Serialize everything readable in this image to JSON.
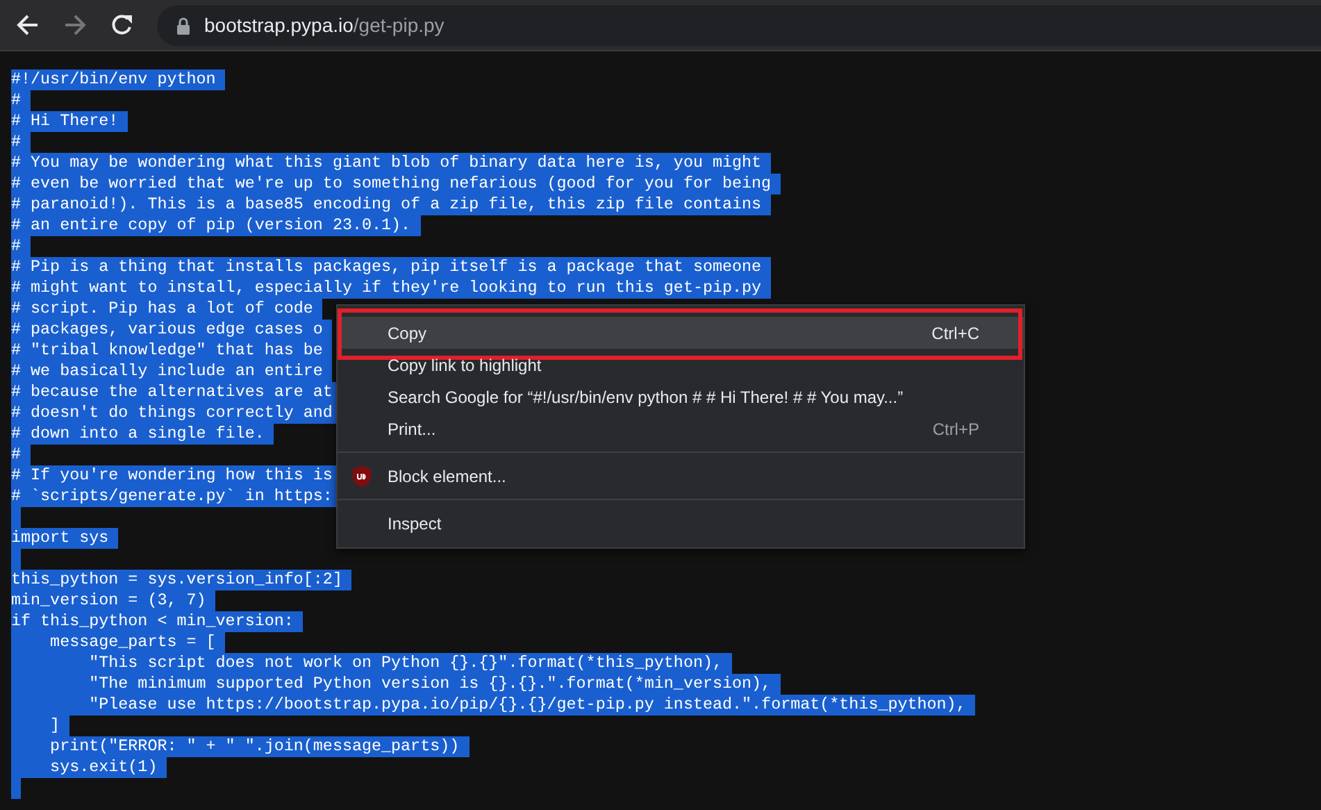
{
  "toolbar": {
    "back": {
      "disabled": false
    },
    "forward": {
      "disabled": true
    },
    "url": {
      "host": "bootstrap.pypa.io",
      "path": "/get-pip.py"
    }
  },
  "code": {
    "selected": true,
    "lines": [
      {
        "kind": "text",
        "text": "#!/usr/bin/env python"
      },
      {
        "kind": "text",
        "text": "#"
      },
      {
        "kind": "text",
        "text": "# Hi There!"
      },
      {
        "kind": "text",
        "text": "#"
      },
      {
        "kind": "text",
        "text": "# You may be wondering what this giant blob of binary data here is, you might"
      },
      {
        "kind": "text",
        "text": "# even be worried that we're up to something nefarious (good for you for being"
      },
      {
        "kind": "text",
        "text": "# paranoid!). This is a base85 encoding of a zip file, this zip file contains"
      },
      {
        "kind": "text",
        "text": "# an entire copy of pip (version 23.0.1)."
      },
      {
        "kind": "text",
        "text": "#"
      },
      {
        "kind": "text",
        "text": "# Pip is a thing that installs packages, pip itself is a package that someone"
      },
      {
        "kind": "text",
        "text": "# might want to install, especially if they're looking to run this get-pip.py"
      },
      {
        "kind": "text",
        "text": "# script. Pip has a lot of code"
      },
      {
        "kind": "text",
        "text": "# packages, various edge cases o"
      },
      {
        "kind": "text",
        "text": "# \"tribal knowledge\" that has be"
      },
      {
        "kind": "text",
        "text": "# we basically include an entire"
      },
      {
        "kind": "text",
        "text": "# because the alternatives are at"
      },
      {
        "kind": "text",
        "text": "# doesn't do things correctly and"
      },
      {
        "kind": "text",
        "text": "# down into a single file."
      },
      {
        "kind": "text",
        "text": "#"
      },
      {
        "kind": "text",
        "text": "# If you're wondering how this is"
      },
      {
        "kind": "text",
        "text": "# `scripts/generate.py` in https:"
      },
      {
        "kind": "blank"
      },
      {
        "kind": "text",
        "text": "import sys"
      },
      {
        "kind": "blank"
      },
      {
        "kind": "text",
        "text": "this_python = sys.version_info[:2]"
      },
      {
        "kind": "text",
        "text": "min_version = (3, 7)"
      },
      {
        "kind": "text",
        "text": "if this_python < min_version:"
      },
      {
        "kind": "text",
        "text": "    message_parts = ["
      },
      {
        "kind": "text",
        "text": "        \"This script does not work on Python {}.{}\".format(*this_python),"
      },
      {
        "kind": "text",
        "text": "        \"The minimum supported Python version is {}.{}.\".format(*min_version),"
      },
      {
        "kind": "text",
        "text": "        \"Please use https://bootstrap.pypa.io/pip/{}.{}/get-pip.py instead.\".format(*this_python),"
      },
      {
        "kind": "text",
        "text": "    ]"
      },
      {
        "kind": "text",
        "text": "    print(\"ERROR: \" + \" \".join(message_parts))"
      },
      {
        "kind": "text",
        "text": "    sys.exit(1)"
      },
      {
        "kind": "blank"
      }
    ]
  },
  "context_menu": {
    "groups": [
      [
        {
          "kind": "plain",
          "label": "Copy",
          "shortcut": "Ctrl+C",
          "selected": true,
          "outlined": true
        },
        {
          "kind": "plain",
          "label": "Copy link to highlight",
          "selected": false,
          "outlined": false
        },
        {
          "kind": "plain",
          "label": "Search Google for “#!/usr/bin/env python # # Hi There! # # You may...”",
          "selected": false,
          "outlined": false
        },
        {
          "kind": "plain",
          "label": "Print...",
          "shortcut": "Ctrl+P",
          "selected": false,
          "outlined": false
        }
      ],
      [
        {
          "kind": "extension",
          "label": "Block element...",
          "selected": false,
          "outlined": false
        }
      ],
      [
        {
          "kind": "plain",
          "label": "Inspect",
          "selected": false,
          "outlined": false
        }
      ]
    ]
  }
}
